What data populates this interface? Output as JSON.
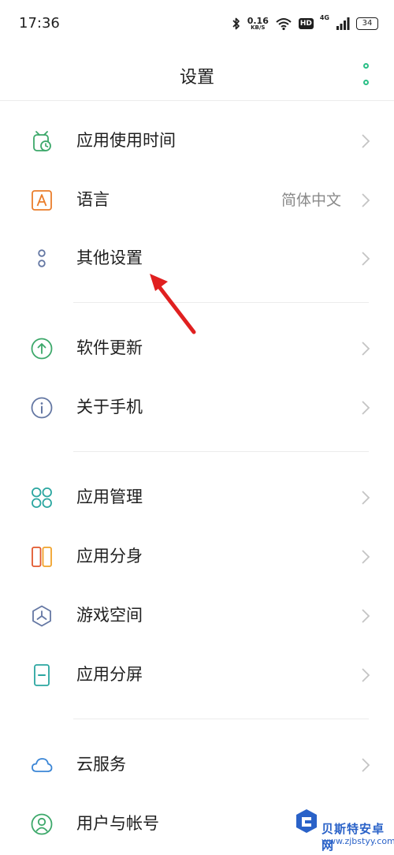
{
  "status_bar": {
    "time": "17:36",
    "speed_value": "0.16",
    "speed_unit": "KB/S",
    "hd": "HD",
    "network": "4G",
    "battery": "34"
  },
  "header": {
    "title": "设置"
  },
  "settings": [
    {
      "label": "应用使用时间",
      "value": ""
    },
    {
      "label": "语言",
      "value": "简体中文"
    },
    {
      "label": "其他设置",
      "value": ""
    },
    {
      "label": "软件更新",
      "value": ""
    },
    {
      "label": "关于手机",
      "value": ""
    },
    {
      "label": "应用管理",
      "value": ""
    },
    {
      "label": "应用分身",
      "value": ""
    },
    {
      "label": "游戏空间",
      "value": ""
    },
    {
      "label": "应用分屏",
      "value": ""
    },
    {
      "label": "云服务",
      "value": ""
    },
    {
      "label": "用户与帐号",
      "value": ""
    }
  ],
  "watermark": {
    "title": "贝斯特安卓网",
    "url": "www.zjbstyy.com"
  },
  "icons": {
    "app-usage-time": "alarm-clock-icon",
    "language": "letter-a-icon",
    "other-settings": "two-circles-icon",
    "software-update": "up-arrow-circle-icon",
    "about-phone": "info-icon",
    "app-management": "four-petal-icon",
    "app-clone": "dual-rectangles-icon",
    "game-space": "hexagon-triangle-icon",
    "split-screen": "split-screen-icon",
    "cloud-service": "cloud-icon",
    "user-account": "user-icon"
  },
  "colors": {
    "accent": "#2bbf87",
    "annotation_arrow": "#e02020",
    "secondary_text": "#8a8a8a",
    "divider": "#ececec",
    "watermark": "#2a62c8"
  }
}
